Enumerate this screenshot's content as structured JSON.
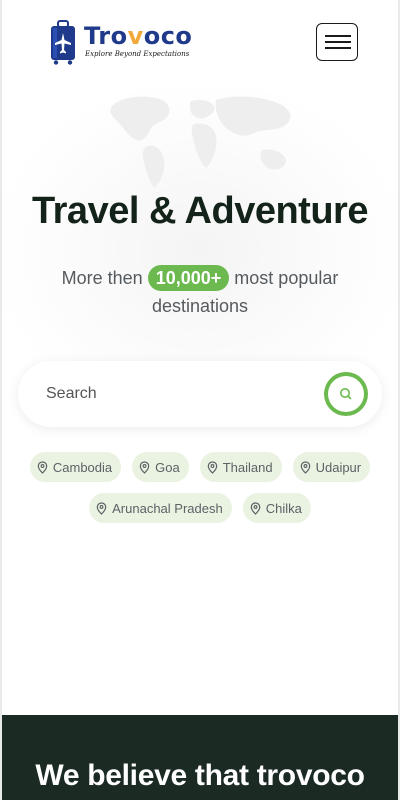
{
  "brand": {
    "name_part1": "Tro",
    "name_part2": "v",
    "name_part3": "oco",
    "tagline": "Explore Beyond Expectations",
    "colors": {
      "primary": "#1f3a8a",
      "accent": "#f2a93b"
    }
  },
  "header": {
    "menu_icon": "hamburger-icon"
  },
  "hero": {
    "title": "Travel & Adventure",
    "subtitle_before": "More then",
    "subtitle_badge": "10,000+",
    "subtitle_after": "most popular destinations"
  },
  "search": {
    "placeholder": "Search",
    "value": "",
    "button_icon": "search-icon"
  },
  "destinations": [
    {
      "label": "Cambodia",
      "icon": "location-pin-icon"
    },
    {
      "label": "Goa",
      "icon": "location-pin-icon"
    },
    {
      "label": "Thailand",
      "icon": "location-pin-icon"
    },
    {
      "label": "Udaipur",
      "icon": "location-pin-icon"
    },
    {
      "label": "Arunachal Pradesh",
      "icon": "location-pin-icon"
    },
    {
      "label": "Chilka",
      "icon": "location-pin-icon"
    }
  ],
  "section": {
    "title": "We believe that trovoco"
  },
  "theme": {
    "green": "#6cba4f",
    "dark": "#1c2a24",
    "tag_bg": "#eaf2e2"
  }
}
